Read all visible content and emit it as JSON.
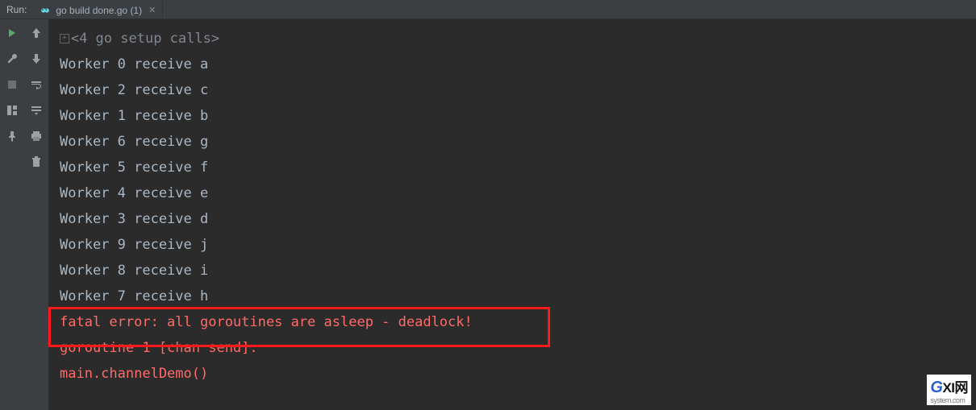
{
  "panel": {
    "title": "Run:"
  },
  "tab": {
    "label": "go build done.go (1)"
  },
  "console": {
    "folded": "<4 go setup calls>",
    "stdout": [
      "Worker 0 receive a",
      "Worker 2 receive c",
      "Worker 1 receive b",
      "Worker 6 receive g",
      "Worker 5 receive f",
      "Worker 4 receive e",
      "Worker 3 receive d",
      "Worker 9 receive j",
      "Worker 8 receive i",
      "Worker 7 receive h"
    ],
    "stderr": [
      "fatal error: all goroutines are asleep - deadlock!",
      "",
      "goroutine 1 [chan send]:",
      "main.channelDemo()"
    ]
  },
  "watermark": {
    "brand": "G",
    "text": "XI网",
    "sub": "system.com"
  }
}
